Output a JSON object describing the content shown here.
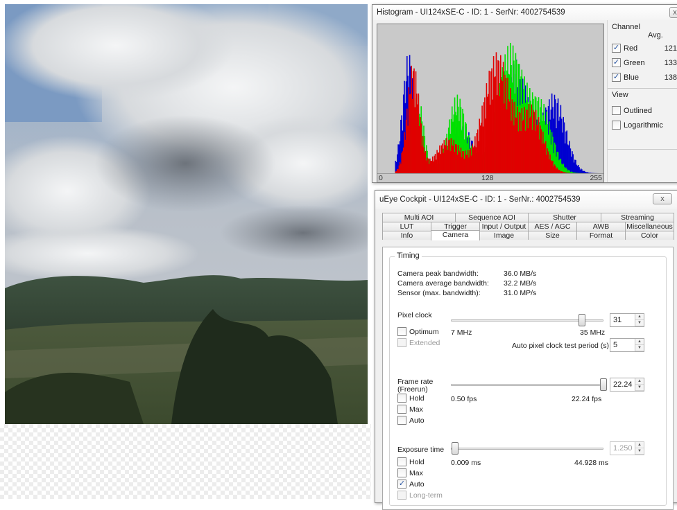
{
  "histogram_window": {
    "title": "Histogram - UI124xSE-C - ID: 1 - SerNr: 4002754539",
    "close_glyph": "x",
    "axis_labels": [
      "0",
      "128",
      "255"
    ],
    "channel_heading": "Channel",
    "avg_heading": "Avg.",
    "channels": [
      {
        "label": "Red",
        "checked": true,
        "avg": "121",
        "color": "#e00000"
      },
      {
        "label": "Green",
        "checked": true,
        "avg": "133",
        "color": "#00e000"
      },
      {
        "label": "Blue",
        "checked": true,
        "avg": "138",
        "color": "#0000d0"
      }
    ],
    "view_heading": "View",
    "view_options": [
      {
        "label": "Outlined",
        "checked": false
      },
      {
        "label": "Logarithmic",
        "checked": false
      }
    ]
  },
  "cockpit_window": {
    "title": "uEye Cockpit - UI124xSE-C - ID: 1 - SerNr.: 4002754539",
    "close_glyph": "x",
    "tab_rows": [
      [
        "Multi AOI",
        "Sequence AOI",
        "Shutter",
        "Streaming"
      ],
      [
        "LUT",
        "Trigger",
        "Input / Output",
        "AES / AGC",
        "AWB",
        "Miscellaneous"
      ],
      [
        "Info",
        "Camera",
        "Image",
        "Size",
        "Format",
        "Color"
      ]
    ],
    "active_tab": "Camera",
    "timing": {
      "group_title": "Timing",
      "stats": [
        {
          "label": "Camera peak bandwidth:",
          "value": "36.0 MB/s"
        },
        {
          "label": "Camera average bandwidth:",
          "value": "32.2 MB/s"
        },
        {
          "label": "Sensor (max. bandwidth):",
          "value": "31.0 MP/s"
        }
      ],
      "pixel_clock": {
        "label": "Pixel clock",
        "min_label": "7 MHz",
        "max_label": "35 MHz",
        "value": "31",
        "level": 0.857,
        "optimum_label": "Optimum",
        "extended_label": "Extended",
        "test_period_label": "Auto pixel clock test period (s)",
        "test_period_value": "5"
      },
      "frame_rate": {
        "label_line1": "Frame rate",
        "label_line2": "(Freerun)",
        "min_label": "0.50 fps",
        "max_label": "22.24 fps",
        "value": "22.24",
        "level": 1.0,
        "hold_label": "Hold",
        "max_cb_label": "Max",
        "auto_label": "Auto"
      },
      "exposure": {
        "label": "Exposure time",
        "min_label": "0.009 ms",
        "max_label": "44.928 ms",
        "value": "1.250",
        "level": 0.028,
        "hold_label": "Hold",
        "max_cb_label": "Max",
        "auto_label": "Auto",
        "auto_checked": true,
        "longterm_label": "Long-term"
      }
    }
  }
}
